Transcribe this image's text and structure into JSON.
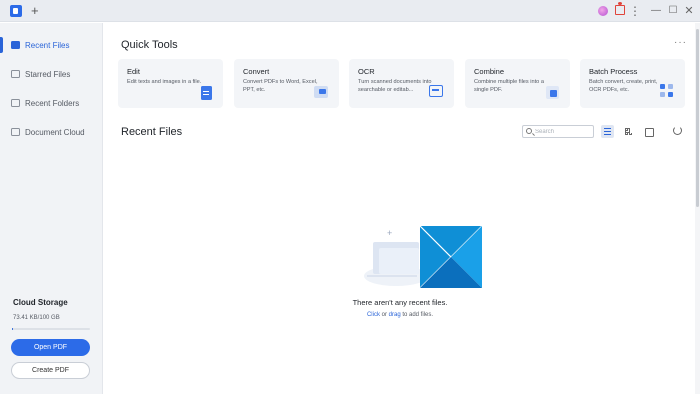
{
  "titlebar": {
    "new_tab_label": "+"
  },
  "sidebar": {
    "items": [
      {
        "label": "Recent Files",
        "icon": "recent-files-icon",
        "active": true
      },
      {
        "label": "Starred Files",
        "icon": "star-icon",
        "active": false
      },
      {
        "label": "Recent Folders",
        "icon": "folder-icon",
        "active": false
      },
      {
        "label": "Document Cloud",
        "icon": "cloud-icon",
        "active": false
      }
    ],
    "cloud_storage": {
      "title": "Cloud Storage",
      "usage": "73.41 KB/100 GB",
      "used_fraction": 0.01
    },
    "open_pdf_label": "Open PDF",
    "create_pdf_label": "Create PDF"
  },
  "quick_tools": {
    "title": "Quick Tools",
    "more_label": "···",
    "cards": [
      {
        "title": "Edit",
        "desc": "Edit texts and images in a file.",
        "icon": "edit-doc-icon"
      },
      {
        "title": "Convert",
        "desc": "Convert PDFs to Word, Excel, PPT, etc.",
        "icon": "convert-icon"
      },
      {
        "title": "OCR",
        "desc": "Turn scanned documents into searchable or editab...",
        "icon": "ocr-scan-icon"
      },
      {
        "title": "Combine",
        "desc": "Combine multiple files into a single PDF.",
        "icon": "combine-icon"
      },
      {
        "title": "Batch Process",
        "desc": "Batch convert, create, print, OCR PDFs, etc.",
        "icon": "batch-process-icon"
      }
    ]
  },
  "recent_files": {
    "title": "Recent Files",
    "search_placeholder": "Search",
    "empty_title": "There aren't any recent files.",
    "hint_click": "Click",
    "hint_or": " or ",
    "hint_drag": "drag",
    "hint_rest": " to add files."
  },
  "colors": {
    "accent": "#2c6be8",
    "sidebar_bg": "#f1f3f6",
    "card_bg": "#f3f5f8"
  }
}
